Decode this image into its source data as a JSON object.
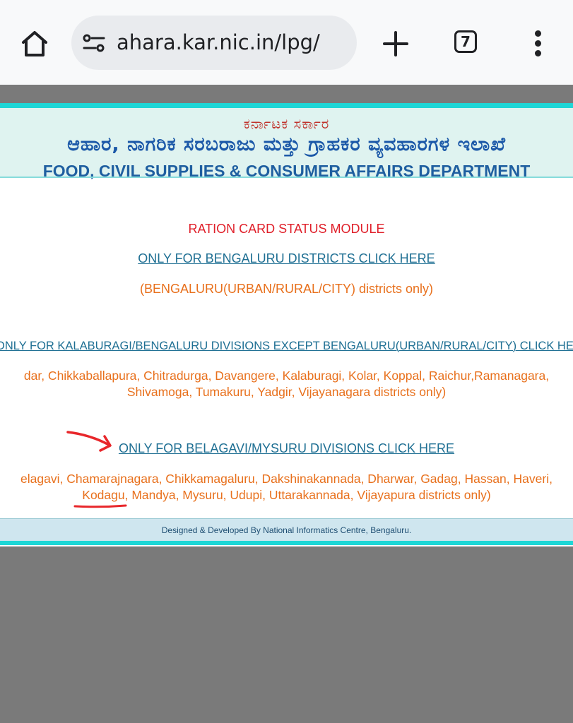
{
  "browser": {
    "url": "ahara.kar.nic.in/lpg/",
    "tab_count": "7"
  },
  "banner": {
    "govt_kn": "ಕರ್ನಾಟಕ ಸರ್ಕಾರ",
    "dept_kn": "ಆಹಾರ, ನಾಗರಿಕ ಸರಬರಾಜು ಮತ್ತು ಗ್ರಾಹಕರ ವ್ಯವಹಾರಗಳ ಇಲಾಖೆ",
    "dept_en": "FOOD, CIVIL SUPPLIES & CONSUMER AFFAIRS DEPARTMENT"
  },
  "content": {
    "module_title": "RATION CARD STATUS MODULE",
    "bengaluru_link": "ONLY FOR BENGALURU DISTRICTS CLICK HERE",
    "bengaluru_note": "(BENGALURU(URBAN/RURAL/CITY) districts only)",
    "kalaburagi_link": "ONLY FOR KALABURAGI/BENGALURU DIVISIONS EXCEPT BENGALURU(URBAN/RURAL/CITY) CLICK HERE",
    "kalaburagi_note_1": "dar, Chikkaballapura, Chitradurga, Davangere, Kalaburagi, Kolar, Koppal, Raichur,Ramanagara,",
    "kalaburagi_note_2": "Shivamoga, Tumakuru, Yadgir, Vijayanagara districts only)",
    "belagavi_link": "ONLY FOR BELAGAVI/MYSURU DIVISIONS CLICK HERE",
    "belagavi_note_1": "elagavi, Chamarajnagara, Chikkamagaluru, Dakshinakannada, Dharwar, Gadag, Hassan, Haveri,",
    "belagavi_note_2": "Kodagu, Mandya, Mysuru, Udupi, Uttarakannada, Vijayapura districts only)"
  },
  "footer": {
    "text": "Designed & Developed By National Informatics Centre, Bengaluru."
  },
  "annotations": {
    "color": "#e8262a"
  }
}
